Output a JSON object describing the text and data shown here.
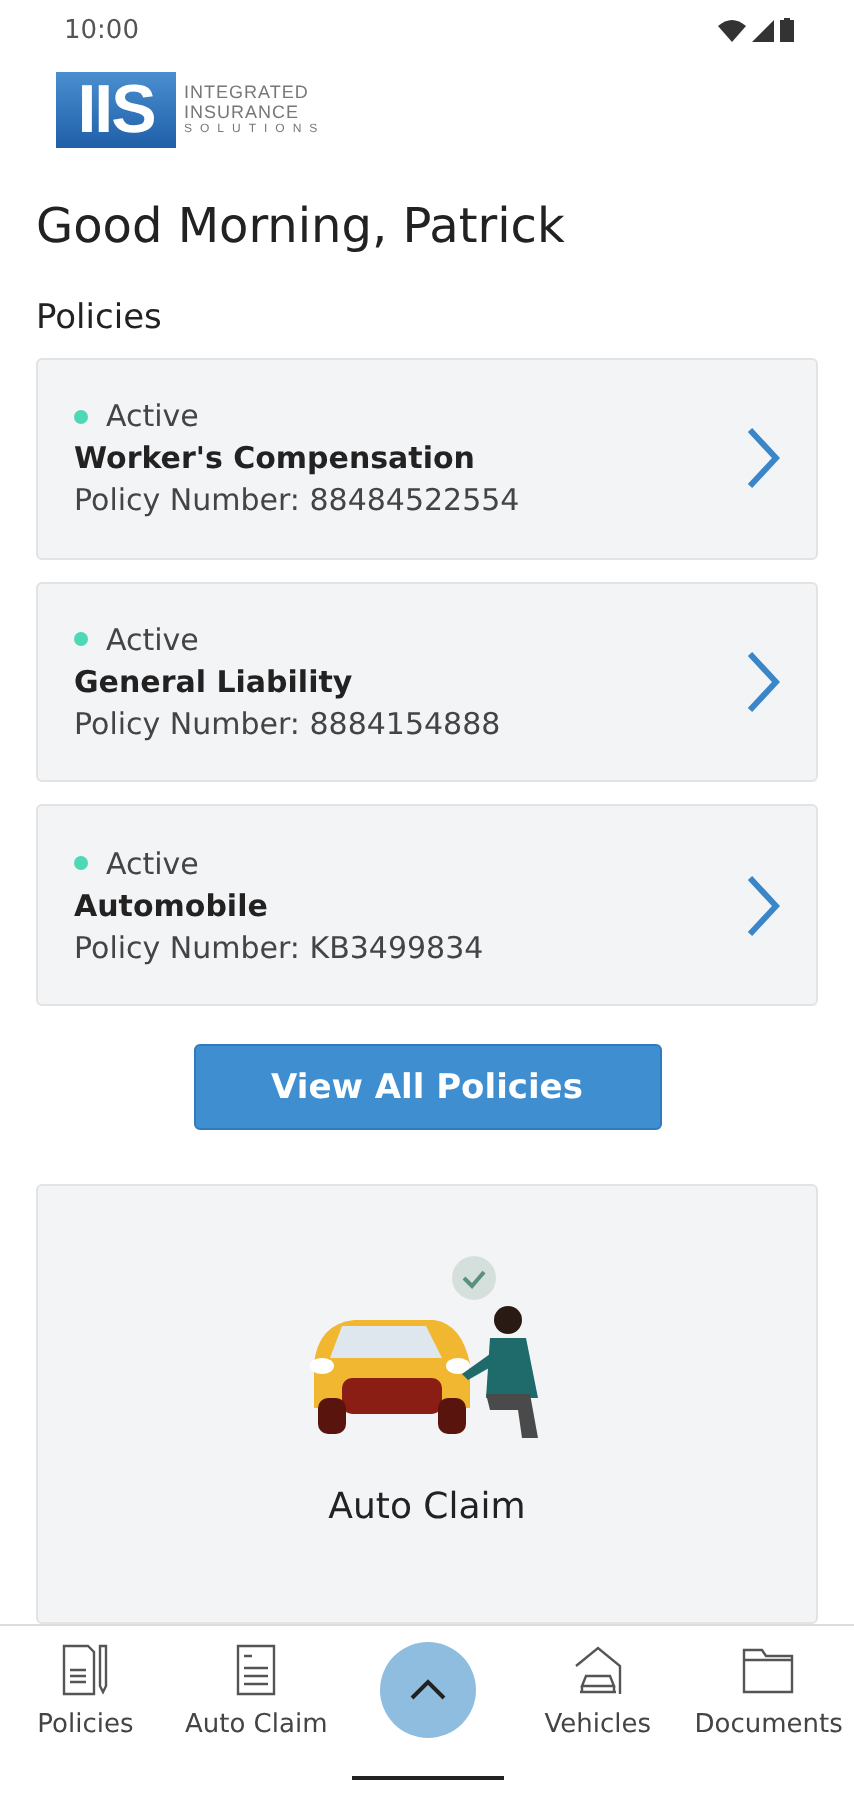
{
  "status_bar": {
    "time": "10:00"
  },
  "logo": {
    "mark": "IIS",
    "lines": [
      "INTEGRATED",
      "INSURANCE",
      "SOLUTIONS"
    ]
  },
  "greeting": "Good Morning, Patrick",
  "section_title": "Policies",
  "policies": [
    {
      "status": "Active",
      "color": "#4fd8b4",
      "name": "Worker's Compensation",
      "number": "Policy Number: 88484522554"
    },
    {
      "status": "Active",
      "color": "#4fd8b4",
      "name": "General Liability",
      "number": "Policy Number: 8884154888"
    },
    {
      "status": "Active",
      "color": "#4fd8b4",
      "name": "Automobile",
      "number": "Policy Number: KB3499834"
    }
  ],
  "view_all_button": "View All Policies",
  "claim_card": {
    "title": "Auto Claim",
    "kind": "picture"
  },
  "nav": [
    {
      "label": "Policies",
      "kind": "policy"
    },
    {
      "label": "Auto Claim",
      "kind": "form"
    },
    {
      "kind": "up"
    },
    {
      "label": "Vehicles",
      "kind": "garage"
    },
    {
      "label": "Documents",
      "kind": "folder"
    }
  ]
}
